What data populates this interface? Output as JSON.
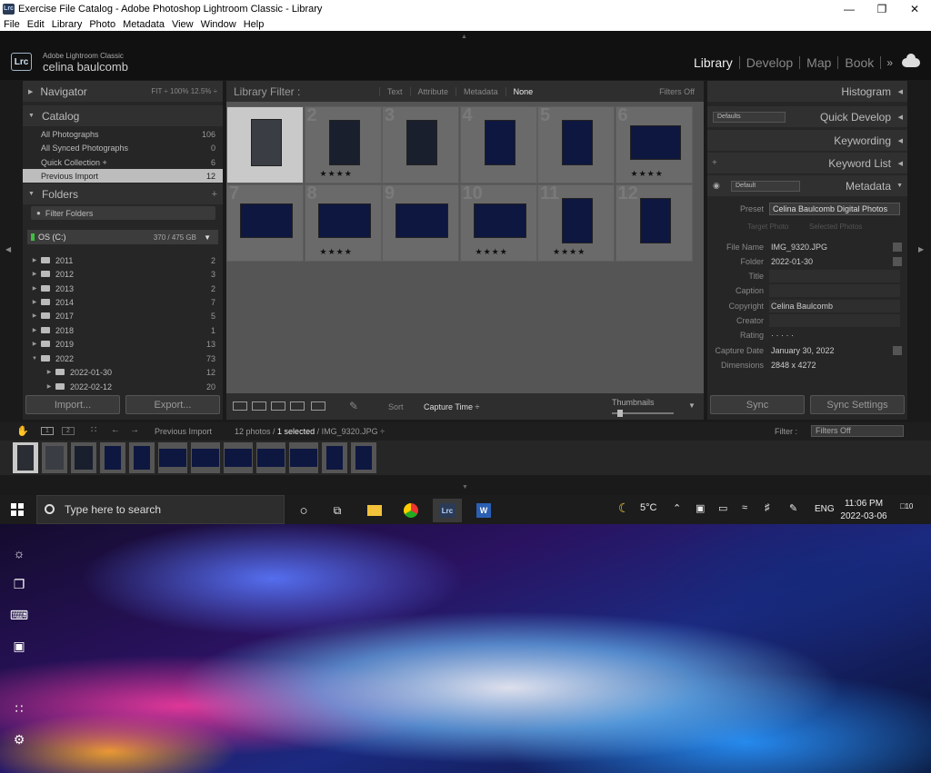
{
  "window": {
    "title": "Exercise File Catalog - Adobe Photoshop Lightroom Classic - Library",
    "app_icon": "Lrc",
    "menu": [
      "File",
      "Edit",
      "Library",
      "Photo",
      "Metadata",
      "View",
      "Window",
      "Help"
    ]
  },
  "identity": {
    "logo": "Lrc",
    "app_name": "Adobe Lightroom Classic",
    "user_name": "celina baulcomb",
    "modules": [
      "Library",
      "Develop",
      "Map",
      "Book"
    ],
    "active_module": "Library",
    "more": "»"
  },
  "navigator": {
    "title": "Navigator",
    "zooms": "FIT ÷   100%   12.5% ÷"
  },
  "catalog": {
    "title": "Catalog",
    "items": [
      {
        "label": "All Photographs",
        "count": "106"
      },
      {
        "label": "All Synced Photographs",
        "count": "0"
      },
      {
        "label": "Quick Collection +",
        "count": "6"
      },
      {
        "label": "Previous Import",
        "count": "12"
      }
    ]
  },
  "folders": {
    "title": "Folders",
    "add": "+",
    "filter_placeholder": "Filter Folders",
    "volume": {
      "name": "OS (C:)",
      "size": "370 / 475 GB"
    },
    "items": [
      {
        "label": "2011",
        "count": "2",
        "expanded": false
      },
      {
        "label": "2012",
        "count": "3",
        "expanded": false
      },
      {
        "label": "2013",
        "count": "2",
        "expanded": false
      },
      {
        "label": "2014",
        "count": "7",
        "expanded": false
      },
      {
        "label": "2017",
        "count": "5",
        "expanded": false
      },
      {
        "label": "2018",
        "count": "1",
        "expanded": false
      },
      {
        "label": "2019",
        "count": "13",
        "expanded": false
      },
      {
        "label": "2022",
        "count": "73",
        "expanded": true
      },
      {
        "label": "2022-01-30",
        "count": "12",
        "expanded": false
      },
      {
        "label": "2022-02-12",
        "count": "20",
        "expanded": false
      }
    ]
  },
  "left_buttons": {
    "import": "Import...",
    "export": "Export..."
  },
  "library_filter": {
    "title": "Library Filter :",
    "options": [
      "Text",
      "Attribute",
      "Metadata",
      "None"
    ],
    "active": "None",
    "filters_off": "Filters Off"
  },
  "grid": {
    "cells": [
      {
        "num": "",
        "stars": "★★★★",
        "selected": true
      },
      {
        "num": "2",
        "stars": "★★★★"
      },
      {
        "num": "3",
        "stars": ""
      },
      {
        "num": "4",
        "stars": ""
      },
      {
        "num": "5",
        "stars": ""
      },
      {
        "num": "6",
        "stars": "★★★★"
      },
      {
        "num": "7",
        "stars": ""
      },
      {
        "num": "8",
        "stars": "★★★★"
      },
      {
        "num": "9",
        "stars": ""
      },
      {
        "num": "10",
        "stars": "★★★★"
      },
      {
        "num": "11",
        "stars": "★★★★"
      },
      {
        "num": "12",
        "stars": ""
      }
    ]
  },
  "toolbar": {
    "sort_label": "Sort",
    "sort_value": "Capture Time ÷",
    "thumbnails_label": "Thumbnails"
  },
  "right": {
    "histogram": "Histogram",
    "quick_develop": "Quick Develop",
    "quick_develop_preset": "Defaults",
    "keywording": "Keywording",
    "keyword_list": "Keyword List",
    "metadata": "Metadata",
    "metadata_preset": "Default",
    "preset_label": "Preset",
    "preset_value": "Celina Baulcomb Digital Photos",
    "target_photo": "Target Photo",
    "selected_photos": "Selected Photos",
    "fields": [
      {
        "label": "File Name",
        "value": "IMG_9320.JPG"
      },
      {
        "label": "Folder",
        "value": "2022-01-30"
      },
      {
        "label": "Title",
        "value": ""
      },
      {
        "label": "Caption",
        "value": ""
      },
      {
        "label": "Copyright",
        "value": "Celina Baulcomb"
      },
      {
        "label": "Creator",
        "value": ""
      },
      {
        "label": "Rating",
        "value": "·   ·   ·   ·   ·"
      },
      {
        "label": "Capture Date",
        "value": "January 30, 2022"
      },
      {
        "label": "Dimensions",
        "value": "2848 x 4272"
      }
    ],
    "sync": "Sync",
    "sync_settings": "Sync Settings"
  },
  "filmstrip": {
    "pages": [
      "1",
      "2"
    ],
    "source": "Previous Import",
    "count": "12 photos / ",
    "selected": "1 selected",
    "file": " / IMG_9320.JPG ÷",
    "filter_label": "Filter :",
    "filter_value": "Filters Off"
  },
  "taskbar": {
    "search_placeholder": "Type here to search",
    "weather": "5°C",
    "lang": "ENG",
    "time": "11:06 PM",
    "date": "2022-03-06",
    "notifications": "10"
  }
}
